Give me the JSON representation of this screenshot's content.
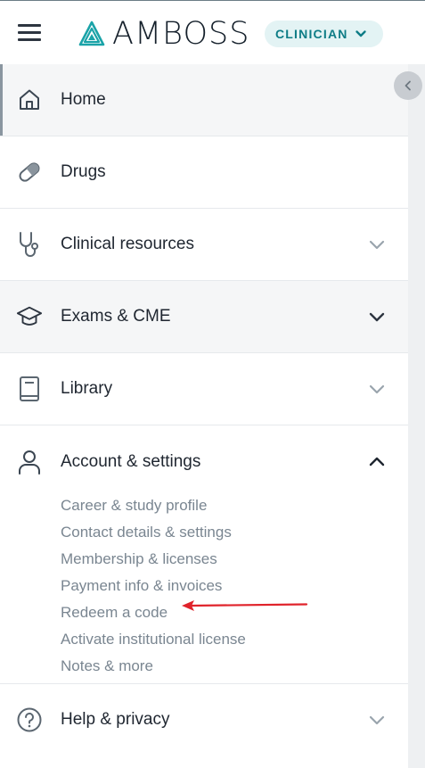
{
  "header": {
    "brand": "AMBOSS",
    "role_badge": "CLINICIAN"
  },
  "nav": {
    "items": [
      {
        "label": "Home",
        "icon": "home-icon"
      },
      {
        "label": "Drugs",
        "icon": "pill-icon"
      },
      {
        "label": "Clinical resources",
        "icon": "stethoscope-icon"
      },
      {
        "label": "Exams & CME",
        "icon": "graduation-cap-icon"
      },
      {
        "label": "Library",
        "icon": "book-icon"
      }
    ],
    "account": {
      "label": "Account & settings",
      "icon": "user-icon",
      "subitems": [
        "Career & study profile",
        "Contact details & settings",
        "Membership & licenses",
        "Payment info & invoices",
        "Redeem a code",
        "Activate institutional license",
        "Notes & more"
      ]
    },
    "help": {
      "label": "Help & privacy",
      "icon": "question-circle-icon"
    }
  },
  "colors": {
    "brand_teal": "#0e7c86",
    "badge_bg": "#e3f3f4",
    "annotation_arrow": "#e0232b"
  }
}
